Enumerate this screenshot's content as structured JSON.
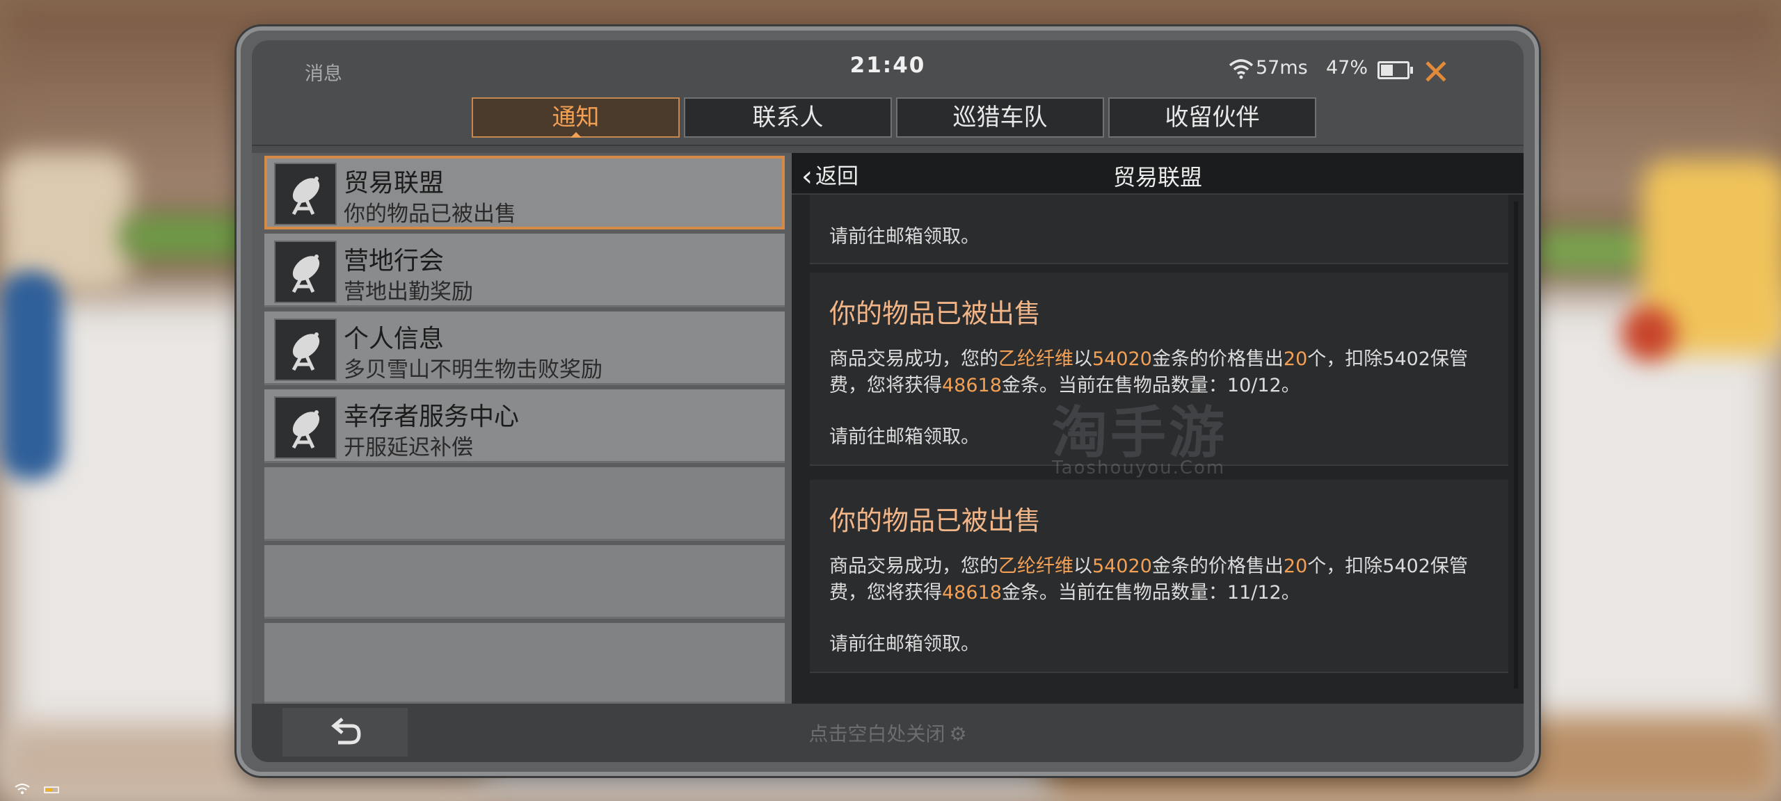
{
  "status_bar": {
    "app_title": "消息",
    "time": "21:40",
    "ping": "57ms",
    "battery": "47%",
    "battery_level": 0.47
  },
  "tabs": [
    {
      "label": "通知",
      "active": true
    },
    {
      "label": "联系人",
      "active": false
    },
    {
      "label": "巡猎车队",
      "active": false
    },
    {
      "label": "收留伙伴",
      "active": false
    }
  ],
  "conversations": [
    {
      "title": "贸易联盟",
      "subtitle": "你的物品已被出售",
      "selected": true
    },
    {
      "title": "营地行会",
      "subtitle": "营地出勤奖励",
      "selected": false
    },
    {
      "title": "个人信息",
      "subtitle": "多贝雪山不明生物击败奖励",
      "selected": false
    },
    {
      "title": "幸存者服务中心",
      "subtitle": "开服延迟补偿",
      "selected": false
    }
  ],
  "detail": {
    "back_label": "返回",
    "title": "贸易联盟",
    "messages": [
      {
        "title": "",
        "pickup": "请前往邮箱领取。"
      },
      {
        "title": "你的物品已被出售",
        "body_parts": [
          "商品交易成功，您的",
          "乙纶纤维",
          "以",
          "54020",
          "金条的价格售出",
          "20",
          "个，扣除",
          "5402",
          "保管费，您将获得",
          "48618",
          "金条。当前在售物品数量：10/12。"
        ],
        "pickup": "请前往邮箱领取。"
      },
      {
        "title": "你的物品已被出售",
        "body_parts": [
          "商品交易成功，您的",
          "乙纶纤维",
          "以",
          "54020",
          "金条的价格售出",
          "20",
          "个，扣除",
          "5402",
          "保管费，您将获得",
          "48618",
          "金条。当前在售物品数量：11/12。"
        ],
        "pickup": "请前往邮箱领取。"
      }
    ]
  },
  "bottom": {
    "hint": "点击空白处关闭"
  },
  "watermark": {
    "main": "淘手游",
    "sub": "Taoshouyou.Com"
  },
  "colors": {
    "accent": "#f3a055",
    "close": "#e08a3a",
    "selected_border": "#d58a45"
  }
}
